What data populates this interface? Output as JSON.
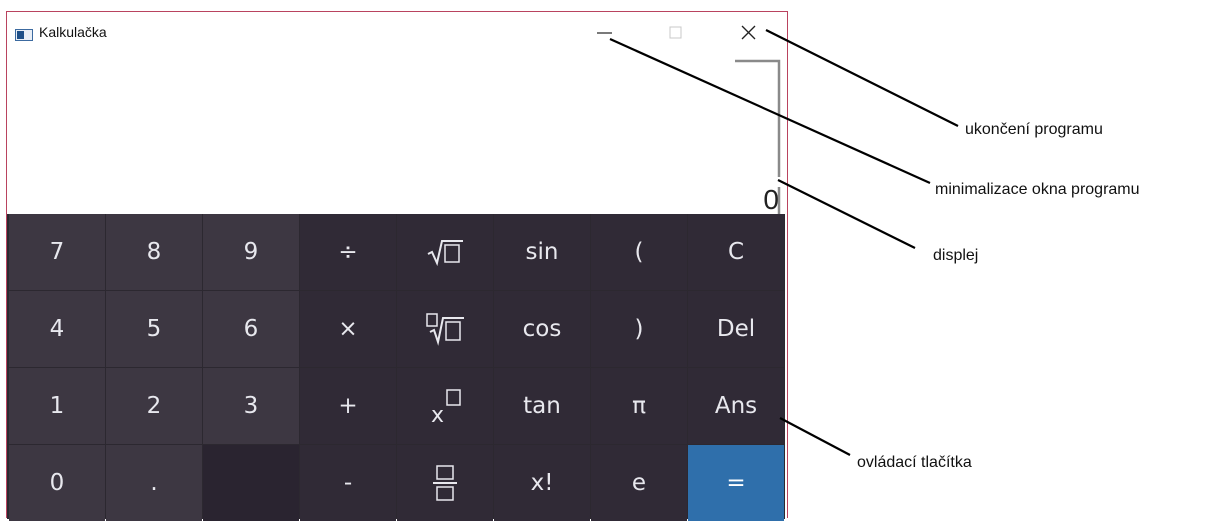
{
  "window": {
    "title": "Kalkulačka",
    "border_color": "#b9435f"
  },
  "titlebar_buttons": {
    "minimize_icon": "minimize-icon",
    "maximize_icon": "maximize-icon",
    "close_icon": "close-icon"
  },
  "display": {
    "value": "0"
  },
  "keypad": {
    "accent_color": "#2f6fab",
    "rows": [
      [
        "7",
        "8",
        "9",
        "÷",
        "√□",
        "sin",
        "(",
        "C"
      ],
      [
        "4",
        "5",
        "6",
        "×",
        "□√□",
        "cos",
        ")",
        "Del"
      ],
      [
        "1",
        "2",
        "3",
        "+",
        "x□",
        "tan",
        "π",
        "Ans"
      ],
      [
        "0",
        ".",
        "",
        "-",
        "□/□",
        "x!",
        "e",
        "="
      ]
    ]
  },
  "annotations": {
    "close": "ukončení programu",
    "minimize": "minimalizace okna programu",
    "display": "displej",
    "buttons": "ovládací tlačítka"
  }
}
